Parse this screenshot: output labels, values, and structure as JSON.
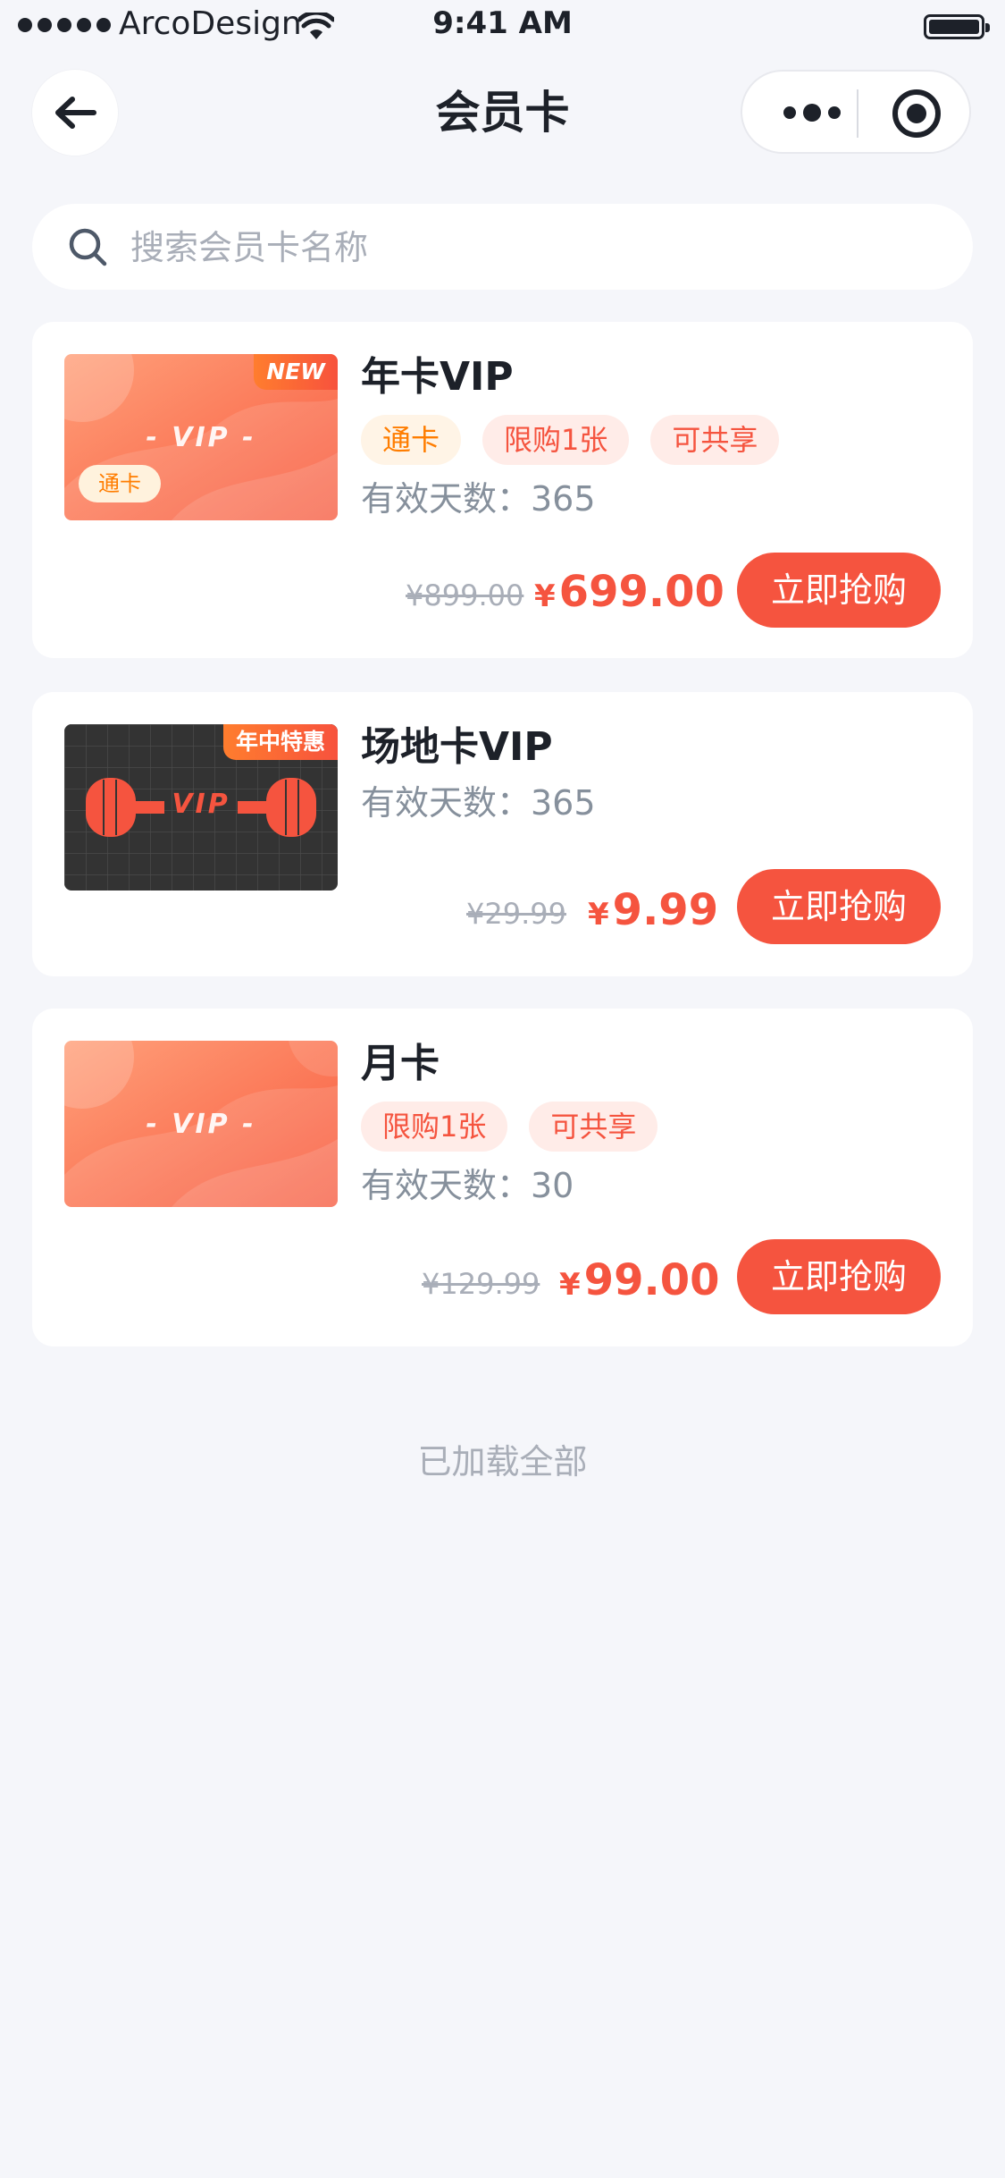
{
  "status_bar": {
    "carrier": "ArcoDesign",
    "time": "9:41 AM"
  },
  "nav": {
    "title": "会员卡"
  },
  "search": {
    "placeholder": "搜索会员卡名称"
  },
  "cards": [
    {
      "title": "年卡VIP",
      "ribbon": "NEW",
      "thumb_tag": "通卡",
      "thumb_text": "- VIP -",
      "tags": [
        "通卡",
        "限购1张",
        "可共享"
      ],
      "days": "有效天数：365",
      "original_price": "¥899.00",
      "currency": "¥",
      "price": "699.00",
      "button": "立即抢购"
    },
    {
      "title": "场地卡VIP",
      "ribbon": "年中特惠",
      "thumb_text": "VIP",
      "tags": [],
      "days": "有效天数：365",
      "original_price": "¥29.99",
      "currency": "¥",
      "price": "9.99",
      "button": "立即抢购"
    },
    {
      "title": "月卡",
      "thumb_text": "- VIP -",
      "tags": [
        "限购1张",
        "可共享"
      ],
      "days": "有效天数：30",
      "original_price": "¥129.99",
      "currency": "¥",
      "price": "99.00",
      "button": "立即抢购"
    }
  ],
  "footer": {
    "text": "已加载全部"
  },
  "colors": {
    "accent": "#f5543f",
    "gold": "#ff7d00",
    "background": "#f5f6fa"
  }
}
